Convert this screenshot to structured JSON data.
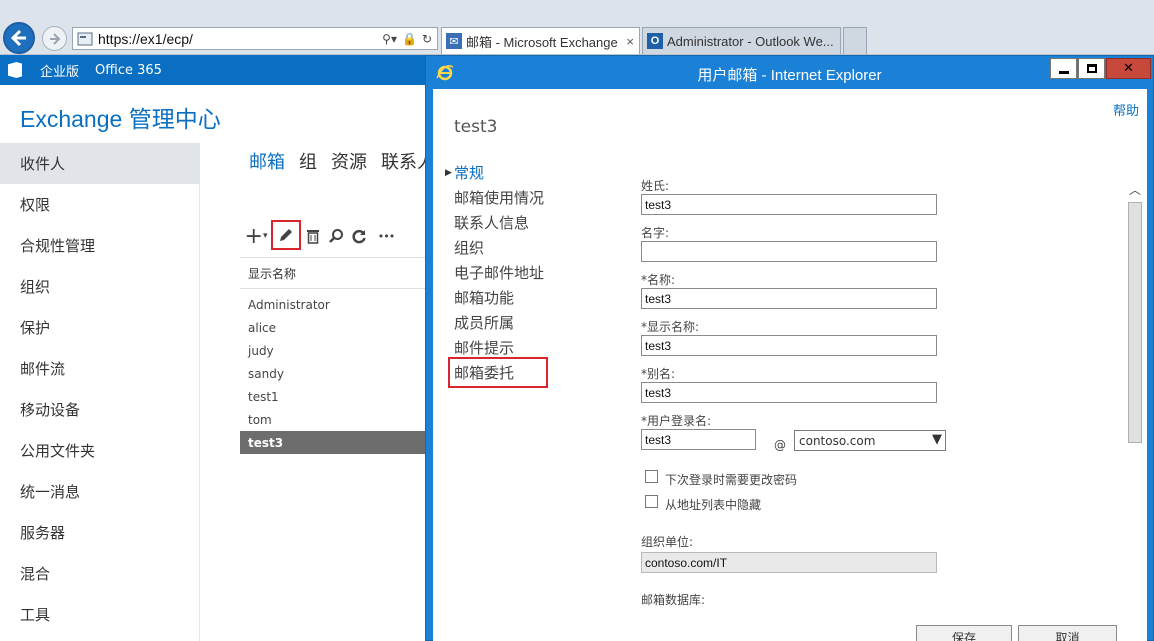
{
  "browser": {
    "url": "https://ex1/ecp/",
    "tabs": [
      {
        "title": "邮箱 - Microsoft Exchange",
        "close": "×"
      },
      {
        "title": "Administrator - Outlook We..."
      }
    ]
  },
  "o365bar": {
    "items": [
      "企业版",
      "Office 365"
    ]
  },
  "eac": {
    "title": "Exchange 管理中心",
    "left_nav": [
      {
        "label": "收件人",
        "selected": true
      },
      {
        "label": "权限"
      },
      {
        "label": "合规性管理"
      },
      {
        "label": "组织"
      },
      {
        "label": "保护"
      },
      {
        "label": "邮件流"
      },
      {
        "label": "移动设备"
      },
      {
        "label": "公用文件夹"
      },
      {
        "label": "统一消息"
      },
      {
        "label": "服务器"
      },
      {
        "label": "混合"
      },
      {
        "label": "工具"
      }
    ],
    "sub_tabs": [
      "邮箱",
      "组",
      "资源",
      "联系人"
    ],
    "toolbar": {
      "add": "+",
      "more": "•••"
    },
    "list_header": "显示名称",
    "mailboxes": [
      "Administrator",
      "alice",
      "judy",
      "sandy",
      "test1",
      "tom",
      "test3"
    ],
    "selected_mailbox": "test3"
  },
  "popup": {
    "title": "用户邮箱 - Internet Explorer",
    "help": "帮助",
    "heading": "test3",
    "sections": [
      "常规",
      "邮箱使用情况",
      "联系人信息",
      "组织",
      "电子邮件地址",
      "邮箱功能",
      "成员所属",
      "邮件提示",
      "邮箱委托"
    ],
    "active_section": "常规",
    "fields": {
      "last_name_label": "姓氏:",
      "last_name": "test3",
      "first_name_label": "名字:",
      "first_name": "",
      "name_label": "*名称:",
      "name": "test3",
      "display_name_label": "*显示名称:",
      "display_name": "test3",
      "alias_label": "*别名:",
      "alias": "test3",
      "logon_label": "*用户登录名:",
      "logon": "test3",
      "at": "@",
      "domain": "contoso.com",
      "change_pwd_label": "下次登录时需要更改密码",
      "hide_label": "从地址列表中隐藏",
      "ou_label": "组织单位:",
      "ou": "contoso.com/IT",
      "db_label": "邮箱数据库:"
    },
    "buttons": {
      "save": "保存",
      "cancel": "取消"
    }
  }
}
